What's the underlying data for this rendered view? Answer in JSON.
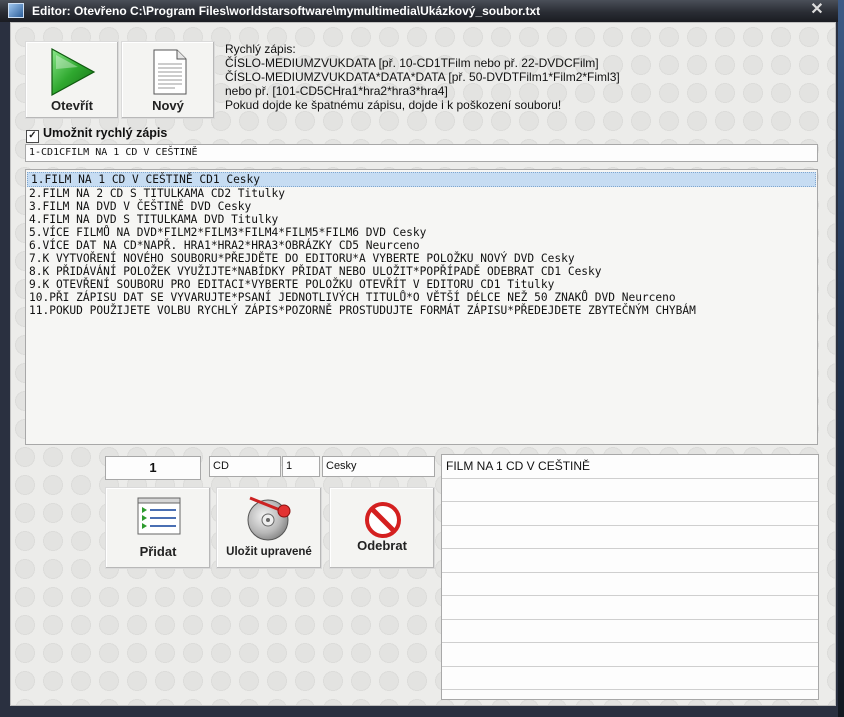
{
  "window": {
    "title": "Editor: Otevřeno C:\\Program Files\\worldstarsoftware\\mymultimedia\\Ukázkový_soubor.txt",
    "close_glyph": "✕"
  },
  "toolbar": {
    "open_label": "Otevřít",
    "new_label": "Nový"
  },
  "info": {
    "lines": [
      "Rychlý zápis:",
      "ČÍSLO-MEDIUMZVUKDATA    [př. 10-CD1TFilm nebo př. 22-DVDCFilm]",
      "ČÍSLO-MEDIUMZVUKDATA*DATA*DATA   [př. 50-DVDTFilm1*Film2*Fiml3]",
      "nebo př. [101-CD5CHra1*hra2*hra3*hra4]",
      "Pokud dojde ke špatnému zápisu, dojde i k poškození souboru!"
    ]
  },
  "quick_entry": {
    "checkbox_label": "Umožnit rychlý zápis",
    "checked": true,
    "value": "1-CD1CFILM NA 1 CD V CEŠTINĚ"
  },
  "list": {
    "items": [
      "1.FILM NA 1 CD V CEŠTINĚ  CD1 Cesky",
      "2.FILM NA 2 CD S TITULKAMA  CD2 Titulky",
      "3.FILM NA DVD V ČEŠTINĚ  DVD Cesky",
      "4.FILM NA DVD S TITULKAMA  DVD Titulky",
      "5.VÍCE FILMŮ NA DVD*FILM2*FILM3*FILM4*FILM5*FILM6  DVD Cesky",
      "6.VÍCE DAT NA CD*NAPŘ. HRA1*HRA2*HRA3*OBRÁZKY  CD5 Neurceno",
      "7.K VYTVOŘENÍ NOVÉHO SOUBORU*PŘEJDĚTE DO EDITORU*A VYBERTE POLOŽKU NOVÝ  DVD Cesky",
      "8.K PŘIDÁVÁNÍ POLOŽEK VYUŽIJTE*NABÍDKY PŘIDAT NEBO ULOŽIT*POPŘÍPADĚ ODEBRAT  CD1 Cesky",
      "9.K OTEVŘENÍ SOUBORU PRO EDITACI*VYBERTE POLOŽKU OTEVŘÍT V EDITORU  CD1 Titulky",
      "10.PŘI ZÁPISU DAT SE VYVARUJTE*PSANÍ JEDNOTLIVÝCH TITULŮ*O VĚTŠÍ DÉLCE NEŽ 50 ZNAKŮ  DVD Neurceno",
      "11.POKUD POUŽIJETE VOLBU RYCHLÝ ZÁPIS*POZORNĚ PROSTUDUJTE FORMÁT ZÁPISU*PŘEDEJDETE ZBYTEČNÝM CHYBÁM"
    ]
  },
  "editor": {
    "number": "1",
    "medium": "CD",
    "count": "1",
    "language": "Cesky",
    "add_label": "Přidat",
    "save_label": "Uložit upravené",
    "remove_label": "Odebrat"
  },
  "details": {
    "rows": [
      "FILM NA 1 CD V CEŠTINĚ",
      "",
      "",
      "",
      "",
      "",
      "",
      "",
      "",
      ""
    ]
  },
  "colors": {
    "selection": "#c6dcf2",
    "play_green": "#2fa82f",
    "remove_red": "#d42020"
  }
}
